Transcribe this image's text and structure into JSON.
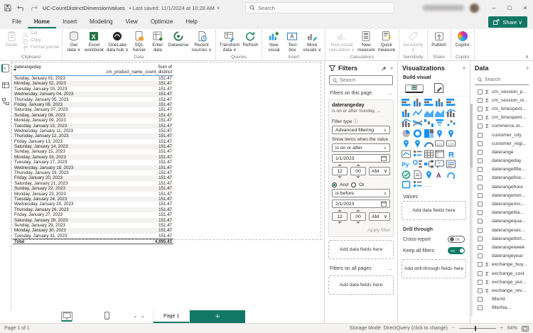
{
  "accent": "#117865",
  "title_bar": {
    "title": "UC-CountDistinctDimensionValues",
    "saved_text": "• Last saved: 11/1/2024 at 10:28 AM",
    "caret": "∨",
    "search_placeholder": "Search",
    "window_controls": {
      "minimize": "–",
      "maximize": "□",
      "close": "×"
    }
  },
  "menu": {
    "items": [
      "File",
      "Home",
      "Insert",
      "Modeling",
      "View",
      "Optimize",
      "Help"
    ],
    "active": "Home",
    "share_label": "Share ∨"
  },
  "ribbon": {
    "collapse": "∧",
    "groups": [
      {
        "name": "Clipboard",
        "layout": "clipboard",
        "buttons": [
          {
            "label": "Paste",
            "icon": "paste",
            "disabled": true
          },
          {
            "label": "Cut",
            "icon": "cut",
            "disabled": true
          },
          {
            "label": "Copy",
            "icon": "copy",
            "disabled": true
          },
          {
            "label": "Format painter",
            "icon": "painter",
            "disabled": true
          }
        ]
      },
      {
        "name": "Data",
        "buttons": [
          {
            "label": "Get\ndata ∨",
            "icon": "getdata"
          },
          {
            "label": "Excel\nworkbook",
            "icon": "excel"
          },
          {
            "label": "OneLake\ndata hub ∨",
            "icon": "onelake"
          },
          {
            "label": "SQL\nServer",
            "icon": "sql"
          },
          {
            "label": "Enter\ndata",
            "icon": "enterdata"
          },
          {
            "label": "Dataverse",
            "icon": "dataverse"
          },
          {
            "label": "Recent\nsources ∨",
            "icon": "recent"
          }
        ]
      },
      {
        "name": "Queries",
        "buttons": [
          {
            "label": "Transform\ndata ∨",
            "icon": "transform"
          },
          {
            "label": "Refresh",
            "icon": "refresh"
          }
        ]
      },
      {
        "name": "Insert",
        "buttons": [
          {
            "label": "New\nvisual",
            "icon": "newvisual"
          },
          {
            "label": "Text\nbox",
            "icon": "textbox"
          },
          {
            "label": "More\nvisuals ∨",
            "icon": "morevisuals"
          }
        ]
      },
      {
        "name": "Calculations",
        "buttons": [
          {
            "label": "New visual\ncalculation ∨",
            "icon": "visualcalc",
            "disabled": true
          },
          {
            "label": "New\nmeasure",
            "icon": "newmeasure"
          },
          {
            "label": "Quick\nmeasure",
            "icon": "quickmeasure"
          }
        ]
      },
      {
        "name": "Sensitivity",
        "buttons": [
          {
            "label": "Sensitivity\n∨",
            "icon": "sensitivity",
            "disabled": true
          }
        ]
      },
      {
        "name": "Share",
        "buttons": [
          {
            "label": "Publish",
            "icon": "publish"
          }
        ]
      },
      {
        "name": "Copilot",
        "buttons": [
          {
            "label": "Copilot",
            "icon": "copilot"
          }
        ]
      }
    ]
  },
  "canvas": {
    "table": {
      "columns": [
        "daterangeday",
        "Sum of cm_product_name_count_distinct"
      ],
      "rows": [
        [
          "Sunday, January 01, 2023",
          "151.47"
        ],
        [
          "Monday, January 02, 2023",
          "151.47"
        ],
        [
          "Tuesday, January 03, 2023",
          "151.47"
        ],
        [
          "Wednesday, January 04, 2023",
          "151.47"
        ],
        [
          "Thursday, January 05, 2023",
          "151.47"
        ],
        [
          "Friday, January 06, 2023",
          "151.47"
        ],
        [
          "Saturday, January 07, 2023",
          "151.47"
        ],
        [
          "Sunday, January 08, 2023",
          "151.47"
        ],
        [
          "Monday, January 09, 2023",
          "151.47"
        ],
        [
          "Tuesday, January 10, 2023",
          "151.47"
        ],
        [
          "Wednesday, January 11, 2023",
          "151.47"
        ],
        [
          "Thursday, January 12, 2023",
          "151.47"
        ],
        [
          "Friday, January 13, 2023",
          "151.47"
        ],
        [
          "Saturday, January 14, 2023",
          "151.47"
        ],
        [
          "Sunday, January 15, 2023",
          "151.47"
        ],
        [
          "Monday, January 16, 2023",
          "151.47"
        ],
        [
          "Tuesday, January 17, 2023",
          "151.47"
        ],
        [
          "Wednesday, January 18, 2023",
          "151.47"
        ],
        [
          "Thursday, January 19, 2023",
          "151.47"
        ],
        [
          "Friday, January 20, 2023",
          "151.47"
        ],
        [
          "Saturday, January 21, 2023",
          "151.47"
        ],
        [
          "Sunday, January 22, 2023",
          "151.47"
        ],
        [
          "Monday, January 23, 2023",
          "151.47"
        ],
        [
          "Tuesday, January 24, 2023",
          "151.47"
        ],
        [
          "Wednesday, January 25, 2023",
          "151.47"
        ],
        [
          "Thursday, January 26, 2023",
          "151.47"
        ],
        [
          "Friday, January 27, 2023",
          "151.47"
        ],
        [
          "Saturday, January 28, 2023",
          "151.47"
        ],
        [
          "Sunday, January 29, 2023",
          "151.47"
        ],
        [
          "Monday, January 30, 2023",
          "151.47"
        ],
        [
          "Tuesday, January 31, 2023",
          "151.47"
        ]
      ],
      "total": [
        "Total",
        "4,695.43"
      ]
    }
  },
  "filters": {
    "header": "Filters",
    "collapse": "»",
    "search_placeholder": "Search",
    "section_page": "Filters on this page",
    "section_all": "Filters on all pages",
    "more": "…",
    "card": {
      "field": "daterangeday",
      "summary": "is on or after Sunday, ...",
      "filter_type_label": "Filter type",
      "info": "ⓘ",
      "filter_type_value": "Advanced filtering",
      "show_items_label": "Show items when the value",
      "condition1": "is on or after",
      "date1": "1/1/2023",
      "hour1": "12",
      "minute1": "00",
      "ampm1": "AM",
      "and_label": "And",
      "or_label": "Or",
      "condition2": "is before",
      "date2": "2/1/2023",
      "hour2": "12",
      "minute2": "00",
      "ampm2": "AM",
      "apply_label": "Apply filter",
      "chevron": "∨"
    },
    "add_fields": "Add data fields here"
  },
  "visualizations": {
    "header": "Visualizations",
    "collapse": "»",
    "build_label": "Build visual",
    "values_label": "Values",
    "add_fields": "Add data fields here",
    "drill_label": "Drill through",
    "cross_report_label": "Cross-report",
    "cross_report_state": "Off",
    "keep_filters_label": "Keep all filters",
    "keep_filters_state": "On",
    "add_drill": "Add drill-through fields here",
    "more": "…",
    "icons": [
      {
        "name": "stacked-bar-chart",
        "glyph": "bh"
      },
      {
        "name": "stacked-column-chart",
        "glyph": "bv"
      },
      {
        "name": "clustered-bar-chart",
        "glyph": "bh"
      },
      {
        "name": "clustered-column-chart",
        "glyph": "bv"
      },
      {
        "name": "100-stacked-bar-chart",
        "glyph": "bh"
      },
      {
        "name": "100-stacked-column-chart",
        "glyph": "bv"
      },
      {
        "name": "line-chart",
        "glyph": "ln"
      },
      {
        "name": "area-chart",
        "glyph": "ar"
      },
      {
        "name": "stacked-area-chart",
        "glyph": "ar"
      },
      {
        "name": "line-and-stacked-column-chart",
        "glyph": "lc"
      },
      {
        "name": "line-and-clustered-column-chart",
        "glyph": "lc"
      },
      {
        "name": "ribbon-chart",
        "glyph": "rb"
      },
      {
        "name": "waterfall-chart",
        "glyph": "wf"
      },
      {
        "name": "funnel-chart",
        "glyph": "fn"
      },
      {
        "name": "scatter-chart",
        "glyph": "sc"
      },
      {
        "name": "pie-chart",
        "glyph": "pi"
      },
      {
        "name": "donut-chart",
        "glyph": "do"
      },
      {
        "name": "treemap",
        "glyph": "tm"
      },
      {
        "name": "map",
        "glyph": "mp"
      },
      {
        "name": "filled-map",
        "glyph": "mp"
      },
      {
        "name": "shape-map",
        "glyph": "mp"
      },
      {
        "name": "azure-map",
        "glyph": "mp"
      },
      {
        "name": "gauge",
        "glyph": "gg"
      },
      {
        "name": "card",
        "glyph": "cd"
      },
      {
        "name": "multi-row-card",
        "glyph": "cd"
      },
      {
        "name": "kpi",
        "glyph": "kp"
      },
      {
        "name": "slicer",
        "glyph": "sl"
      },
      {
        "name": "table",
        "glyph": "tb"
      },
      {
        "name": "matrix",
        "glyph": "mx"
      },
      {
        "name": "r-script-visual",
        "glyph": "R"
      },
      {
        "name": "python-visual",
        "glyph": "Py"
      },
      {
        "name": "key-influencers",
        "glyph": "ki"
      },
      {
        "name": "decomposition-tree",
        "glyph": "tr"
      },
      {
        "name": "qa-visual",
        "glyph": "qa"
      },
      {
        "name": "smart-narrative",
        "glyph": "nr"
      },
      {
        "name": "metrics",
        "glyph": "gl"
      },
      {
        "name": "paginated-report",
        "glyph": "pr"
      },
      {
        "name": "arcgis-map",
        "glyph": "mp"
      },
      {
        "name": "power-apps-visual",
        "glyph": "pa"
      },
      {
        "name": "power-automate-visual",
        "glyph": "fl"
      },
      {
        "name": "shape-visual",
        "glyph": "sh"
      },
      {
        "name": "new-slicer",
        "glyph": "sl"
      }
    ]
  },
  "data_pane": {
    "header": "Data",
    "collapse": "»",
    "search_placeholder": "Search",
    "fields": [
      {
        "name": "cm_session_p...",
        "sigma": true
      },
      {
        "name": "cm_session_st...",
        "sigma": true
      },
      {
        "name": "cm_timespent...",
        "sigma": true
      },
      {
        "name": "cm_timespent...",
        "sigma": true
      },
      {
        "name": "commerce.or...",
        "sigma": true
      },
      {
        "name": "customer_city",
        "sigma": false
      },
      {
        "name": "customer_regi...",
        "sigma": false
      },
      {
        "name": "daterange",
        "sigma": false
      },
      {
        "name": "daterangeday",
        "sigma": false
      },
      {
        "name": "daterangefifte...",
        "sigma": false
      },
      {
        "name": "daterangefive...",
        "sigma": false
      },
      {
        "name": "daterangehour",
        "sigma": false
      },
      {
        "name": "daterangemin...",
        "sigma": false
      },
      {
        "name": "daterangemo...",
        "sigma": false
      },
      {
        "name": "daterangeNa...",
        "sigma": false
      },
      {
        "name": "daterangequa...",
        "sigma": false
      },
      {
        "name": "daterangesec...",
        "sigma": false
      },
      {
        "name": "daterangethirt...",
        "sigma": false
      },
      {
        "name": "daterangeweek",
        "sigma": false
      },
      {
        "name": "daterangeyear",
        "sigma": false
      },
      {
        "name": "exchange_buy...",
        "sigma": true
      },
      {
        "name": "exchange_cost",
        "sigma": true
      },
      {
        "name": "exchange_pur...",
        "sigma": true
      },
      {
        "name": "exchange_rev...",
        "sigma": true
      },
      {
        "name": "filterId",
        "sigma": false
      },
      {
        "name": "filterNa...",
        "sigma": false
      }
    ]
  },
  "page_bar": {
    "page_tab": "Page 1",
    "nav_prev": "◂",
    "nav_next": "▸",
    "add": "+"
  },
  "status_bar": {
    "left": "Page 1 of 1",
    "storage": "Storage Mode: DirectQuery (click to change)",
    "zoom_minus": "−",
    "zoom_plus": "+",
    "zoom": "64%"
  }
}
